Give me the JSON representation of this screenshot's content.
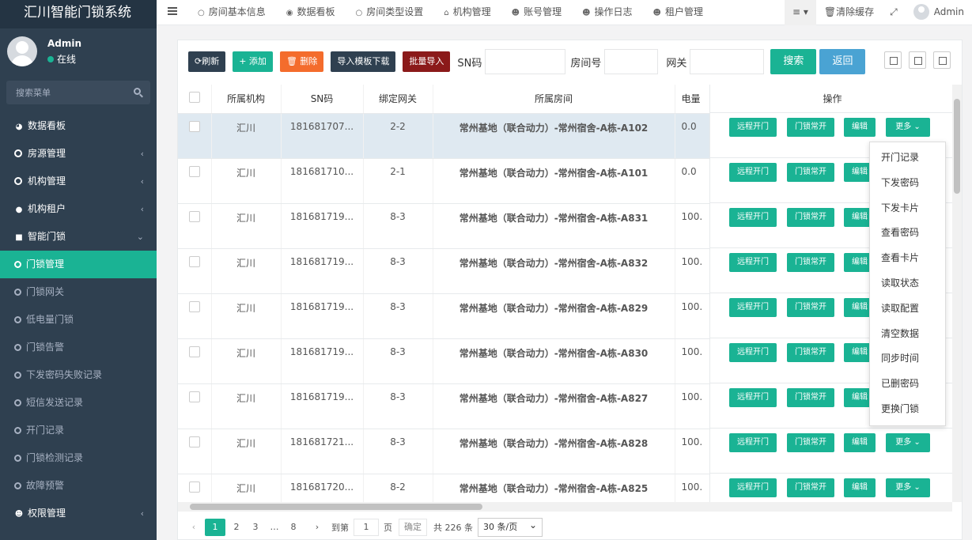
{
  "brand": "汇川智能门锁系统",
  "user": {
    "name": "Admin",
    "status": "在线"
  },
  "sidebar": {
    "search_placeholder": "搜索菜单",
    "items": [
      {
        "label": "数据看板",
        "icon": "dashboard-icon",
        "type": "menu"
      },
      {
        "label": "房源管理",
        "icon": "circle-icon",
        "type": "menu",
        "chevron": "‹"
      },
      {
        "label": "机构管理",
        "icon": "circle-icon",
        "type": "menu",
        "chevron": "‹"
      },
      {
        "label": "机构租户",
        "icon": "user-icon",
        "type": "menu",
        "chevron": "‹"
      },
      {
        "label": "智能门锁",
        "icon": "lock-icon",
        "type": "menu",
        "chevron": "⌄"
      },
      {
        "label": "门锁管理",
        "type": "sub",
        "active": true
      },
      {
        "label": "门锁网关",
        "type": "sub"
      },
      {
        "label": "低电量门锁",
        "type": "sub"
      },
      {
        "label": "门锁告警",
        "type": "sub"
      },
      {
        "label": "下发密码失败记录",
        "type": "sub"
      },
      {
        "label": "短信发送记录",
        "type": "sub"
      },
      {
        "label": "开门记录",
        "type": "sub"
      },
      {
        "label": "门锁检测记录",
        "type": "sub"
      },
      {
        "label": "故障预警",
        "type": "sub"
      },
      {
        "label": "权限管理",
        "icon": "users-icon",
        "type": "menu",
        "chevron": "‹"
      }
    ]
  },
  "topbar": {
    "tabs": [
      {
        "label": "房间基本信息",
        "icon": "○"
      },
      {
        "label": "数据看板",
        "icon": "◉"
      },
      {
        "label": "房间类型设置",
        "icon": "○"
      },
      {
        "label": "机构管理",
        "icon": "⌂"
      },
      {
        "label": "账号管理",
        "icon": "☻"
      },
      {
        "label": "操作日志",
        "icon": "☻"
      },
      {
        "label": "租户管理",
        "icon": "☻"
      }
    ],
    "menu_btn": "≡ ▾",
    "clear_cache": "🗑清除缓存",
    "fullscreen": "⤢",
    "admin": "Admin"
  },
  "toolbar": {
    "refresh": "⟳刷新",
    "add": "+ 添加",
    "delete": "🗑 删除",
    "import_template": "导入模板下载",
    "batch_import": "批量导入",
    "sn_label": "SN码",
    "room_label": "房间号",
    "gateway_label": "网关",
    "search": "搜索",
    "back": "返回"
  },
  "table": {
    "headers": {
      "org": "所属机构",
      "sn": "SN码",
      "gateway": "绑定网关",
      "room": "所属房间",
      "battery": "电量",
      "ops": "操作"
    },
    "rows": [
      {
        "org": "汇川",
        "sn": "181681707...",
        "gateway": "2-2",
        "room": "常州基地（联合动力）-常州宿舍-A栋-A102",
        "battery": "0.0",
        "more": "更多 ⌄"
      },
      {
        "org": "汇川",
        "sn": "181681710...",
        "gateway": "2-1",
        "room": "常州基地（联合动力）-常州宿舍-A栋-A101",
        "battery": "0.0",
        "more": "更多 ⌄"
      },
      {
        "org": "汇川",
        "sn": "181681719...",
        "gateway": "8-3",
        "room": "常州基地（联合动力）-常州宿舍-A栋-A831",
        "battery": "100.",
        "more": "更多 ⌄"
      },
      {
        "org": "汇川",
        "sn": "181681719...",
        "gateway": "8-3",
        "room": "常州基地（联合动力）-常州宿舍-A栋-A832",
        "battery": "100.",
        "more": "更多 ⌄"
      },
      {
        "org": "汇川",
        "sn": "181681719...",
        "gateway": "8-3",
        "room": "常州基地（联合动力）-常州宿舍-A栋-A829",
        "battery": "100.",
        "more": "更多 ⌄"
      },
      {
        "org": "汇川",
        "sn": "181681719...",
        "gateway": "8-3",
        "room": "常州基地（联合动力）-常州宿舍-A栋-A830",
        "battery": "100.",
        "more": "更多 ⌄"
      },
      {
        "org": "汇川",
        "sn": "181681719...",
        "gateway": "8-3",
        "room": "常州基地（联合动力）-常州宿舍-A栋-A827",
        "battery": "100.",
        "more": "更多 ⌄"
      },
      {
        "org": "汇川",
        "sn": "181681721...",
        "gateway": "8-3",
        "room": "常州基地（联合动力）-常州宿舍-A栋-A828",
        "battery": "100.",
        "more": "更多 ⌄"
      },
      {
        "org": "汇川",
        "sn": "181681720...",
        "gateway": "8-2",
        "room": "常州基地（联合动力）-常州宿舍-A栋-A825",
        "battery": "100.",
        "more": "更多 ⌄"
      }
    ],
    "op_buttons": {
      "remote_open": "远程开门",
      "keep_open": "门锁常开",
      "edit": "编辑"
    }
  },
  "dropdown": [
    "开门记录",
    "下发密码",
    "下发卡片",
    "查看密码",
    "查看卡片",
    "读取状态",
    "读取配置",
    "清空数据",
    "同步时间",
    "已删密码",
    "更换门锁"
  ],
  "pager": {
    "prev": "‹",
    "pages": [
      "1",
      "2",
      "3",
      "…",
      "8"
    ],
    "next": "›",
    "goto_label": "到第",
    "goto_value": "1",
    "page_unit": "页",
    "confirm": "确定",
    "total": "共 226 条",
    "per_page": "30 条/页"
  }
}
